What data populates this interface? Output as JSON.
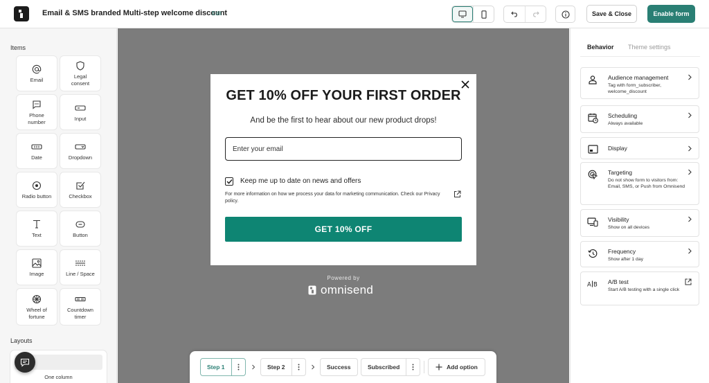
{
  "header": {
    "title": "Email & SMS branded Multi-step welcome discount",
    "edit_label": "Edit",
    "save_close_label": "Save & Close",
    "enable_label": "Enable form",
    "device_active": "desktop"
  },
  "sidebar": {
    "items_heading": "Items",
    "items": [
      {
        "label": "Email",
        "icon": "at-icon"
      },
      {
        "label": "Legal consent",
        "icon": "shield-icon"
      },
      {
        "label": "Phone number",
        "icon": "message-icon"
      },
      {
        "label": "Input",
        "icon": "input-icon"
      },
      {
        "label": "Date",
        "icon": "date-icon"
      },
      {
        "label": "Dropdown",
        "icon": "dropdown-icon"
      },
      {
        "label": "Radio button",
        "icon": "radio-icon"
      },
      {
        "label": "Checkbox",
        "icon": "checkbox-icon"
      },
      {
        "label": "Text",
        "icon": "text-icon"
      },
      {
        "label": "Button",
        "icon": "button-icon"
      },
      {
        "label": "Image",
        "icon": "image-icon"
      },
      {
        "label": "Line / Space",
        "icon": "line-space-icon"
      },
      {
        "label": "Wheel of fortune",
        "icon": "wheel-icon"
      },
      {
        "label": "Countdown timer",
        "icon": "countdown-icon"
      }
    ],
    "layouts_heading": "Layouts",
    "layout_label": "One column"
  },
  "popup": {
    "headline": "GET 10% OFF YOUR FIRST ORDER",
    "subheadline": "And be the first to hear about our new product drops!",
    "email_placeholder": "Enter your email",
    "consent_label": "Keep me up to date on news and offers",
    "consent_checked": true,
    "privacy_text": "For more information on how we process your data for marketing communication. Check our Privacy policy.",
    "cta_label": "GET 10% OFF",
    "cta_color": "#0e8573",
    "powered_by": "Powered by",
    "brand_name": "omnisend"
  },
  "steps": {
    "items": [
      {
        "label": "Step 1",
        "active": true
      },
      {
        "label": "Step 2",
        "active": false
      },
      {
        "label": "Success",
        "active": false
      },
      {
        "label": "Subscribed",
        "active": false
      }
    ],
    "add_option_label": "Add option"
  },
  "right_panel": {
    "tabs": [
      {
        "label": "Behavior",
        "active": true
      },
      {
        "label": "Theme settings",
        "active": false
      }
    ],
    "cards": [
      {
        "title": "Audience management",
        "desc": "Tag with form_subscriber, welcome_discount",
        "icon": "person-icon",
        "action": "chevron-right-icon"
      },
      {
        "title": "Scheduling",
        "desc": "Always available",
        "icon": "calendar-clock-icon",
        "action": "chevron-right-icon"
      },
      {
        "title": "Display",
        "desc": "",
        "icon": "display-icon",
        "action": "chevron-right-icon"
      },
      {
        "title": "Targeting",
        "desc": "Do not show form to visitors from: Email, SMS, or Push from Omnisend",
        "icon": "target-icon",
        "action": "chevron-right-icon"
      },
      {
        "title": "Visibility",
        "desc": "Show on all devices",
        "icon": "devices-icon",
        "action": "chevron-right-icon"
      },
      {
        "title": "Frequency",
        "desc": "Show after 1 day",
        "icon": "history-icon",
        "action": "chevron-right-icon"
      },
      {
        "title": "A/B test",
        "desc": "Start A/B testing with a single click",
        "icon": "ab-test-icon",
        "action": "external-link-icon"
      }
    ]
  },
  "colors": {
    "accent": "#2a7f74",
    "canvas_bg": "#7c7c7c"
  }
}
